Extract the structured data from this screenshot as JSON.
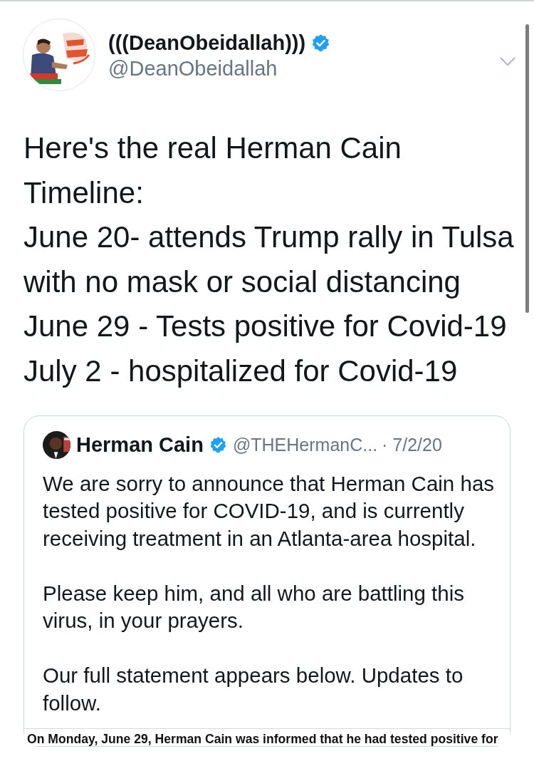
{
  "tweet": {
    "author": {
      "name": "(((DeanObeidallah)))",
      "verified": true,
      "handle": "@DeanObeidallah"
    },
    "text": [
      "Here's the real Herman Cain Timeline:",
      "June 20- attends Trump rally in Tulsa with no mask or social distancing",
      "June 29 - Tests positive for Covid-19",
      "July 2 - hospitalized for Covid-19"
    ],
    "quoted": {
      "author": {
        "name": "Herman Cain",
        "verified": true,
        "handle": "@THEHermanC...",
        "date": "· 7/2/20"
      },
      "paragraphs": [
        "We are sorry to announce that Herman Cain has tested positive for COVID-19, and is currently receiving treatment in an Atlanta-area hospital.",
        "Please keep him, and all who are battling this virus, in your prayers.",
        "Our full statement appears below. Updates to follow."
      ],
      "document": {
        "text": "On Monday, June 29, Herman Cain was informed that he had tested positive for"
      }
    }
  }
}
